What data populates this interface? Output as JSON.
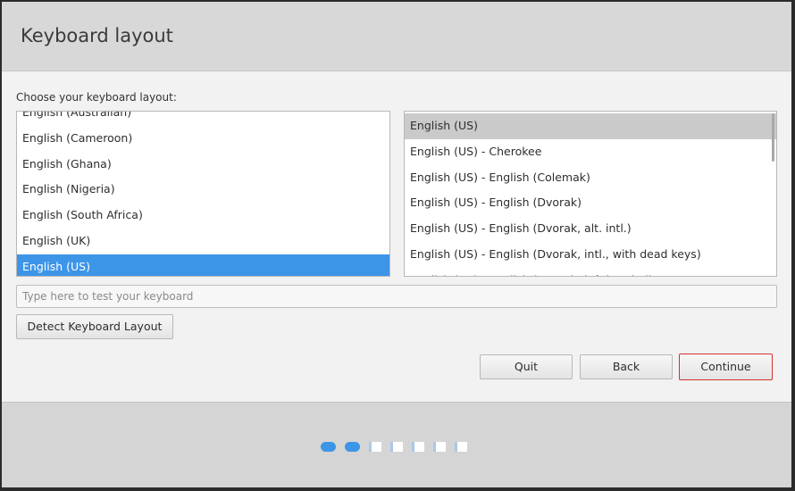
{
  "header": {
    "title": "Keyboard layout"
  },
  "prompt": "Choose your keyboard layout:",
  "layouts": [
    "English (Australian)",
    "English (Cameroon)",
    "English (Ghana)",
    "English (Nigeria)",
    "English (South Africa)",
    "English (UK)",
    "English (US)"
  ],
  "variants": [
    "English (US)",
    "English (US) - Cherokee",
    "English (US) - English (Colemak)",
    "English (US) - English (Dvorak)",
    "English (US) - English (Dvorak, alt. intl.)",
    "English (US) - English (Dvorak, intl., with dead keys)",
    "English (US) - English (Dvorak, left-handed)"
  ],
  "test_input": {
    "value": "",
    "placeholder": "Type here to test your keyboard"
  },
  "buttons": {
    "detect": "Detect Keyboard Layout",
    "quit": "Quit",
    "back": "Back",
    "continue": "Continue"
  },
  "progress": {
    "total": 7,
    "completed": 2
  },
  "colors": {
    "selection": "#3d95e8",
    "focus_border": "#d63030"
  }
}
